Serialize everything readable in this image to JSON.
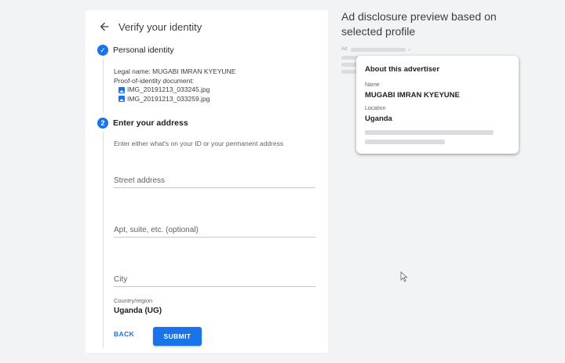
{
  "form": {
    "title": "Verify your identity",
    "step1": {
      "number": "✓",
      "title": "Personal identity"
    },
    "details": {
      "legal_name_label": "Legal name:",
      "legal_name_value": "MUGABI IMRAN KYEYUNE",
      "proof_label": "Proof-of-identity document:",
      "files": [
        "IMG_20191213_033245.jpg",
        "IMG_20191213_033259.jpg"
      ]
    },
    "step2": {
      "number": "2",
      "title": "Enter your address"
    },
    "hint": "Enter either what's on your ID or your permanent address",
    "street_placeholder": "Street address",
    "apt_placeholder": "Apt, suite, etc. (optional)",
    "city_placeholder": "City",
    "country_label": "Country/region",
    "country_value": "Uganda (UG)",
    "back_label": "BACK",
    "submit_label": "SUBMIT"
  },
  "preview": {
    "title": "Ad disclosure preview based on selected profile",
    "ad_label": "Ad",
    "popup": {
      "title": "About this advertiser",
      "name_label": "Name",
      "name_value": "MUGABI IMRAN KYEYUNE",
      "location_label": "Location",
      "location_value": "Uganda"
    }
  },
  "colors": {
    "accent": "#1a73e8",
    "background": "#f1f3f4",
    "card": "#ffffff"
  },
  "icons": {
    "back": "arrow-left-icon",
    "step_done": "check-circle-icon",
    "file": "image-file-icon",
    "cursor": "mouse-pointer-icon"
  }
}
